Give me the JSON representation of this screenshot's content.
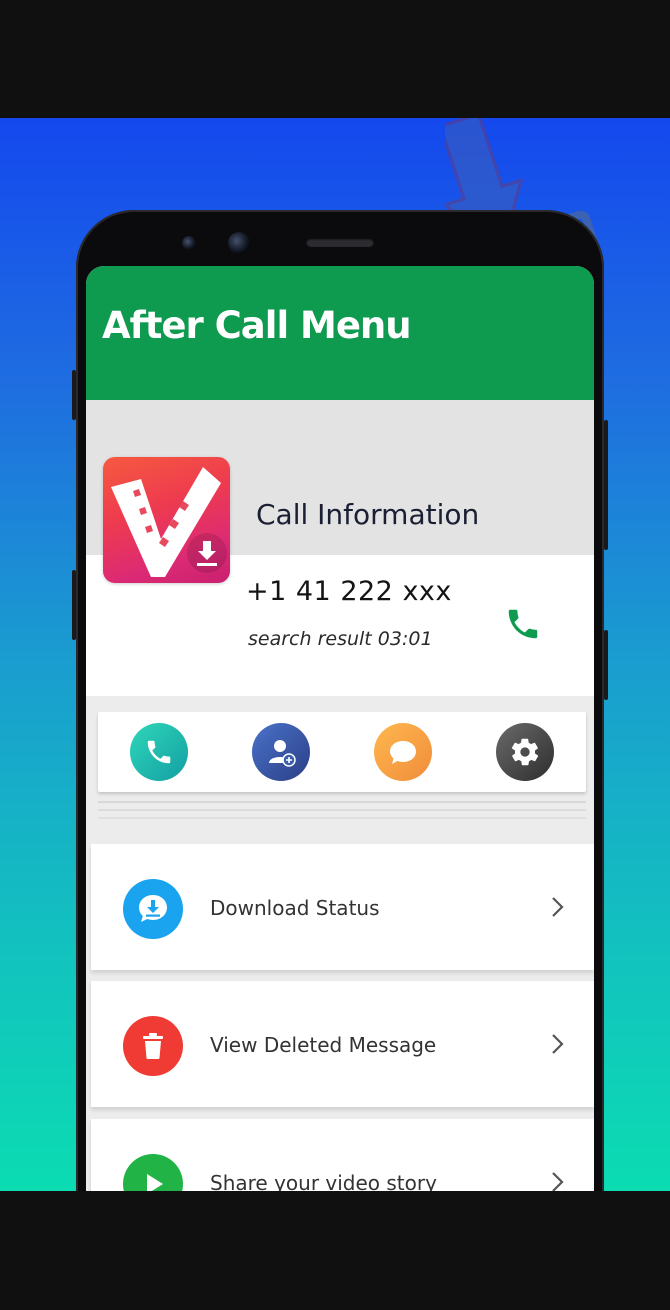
{
  "header": {
    "title": "After Call Menu"
  },
  "call_info": {
    "title": "Call Information",
    "number": "+1 41 222 xxx",
    "subtitle": "search result 03:01",
    "call_icon": "phone-icon",
    "app_icon": "video-downloader-app-icon"
  },
  "quick_actions": [
    {
      "icon": "phone-icon",
      "color": "#1bbfa8"
    },
    {
      "icon": "add-contact-icon",
      "color": "#3c5fb0"
    },
    {
      "icon": "chat-bubble-icon",
      "color": "#f7a04a"
    },
    {
      "icon": "gear-icon",
      "color": "#444444"
    }
  ],
  "menu": [
    {
      "label": "Download Status",
      "icon": "download-icon",
      "color": "#1aa3ef"
    },
    {
      "label": "View Deleted Message",
      "icon": "trash-icon",
      "color": "#ef3b33"
    },
    {
      "label": "Share your video story",
      "icon": "play-icon",
      "color": "#21b345"
    }
  ],
  "colors": {
    "header": "#0e9a4f",
    "accent_call": "#0e9a4f"
  }
}
